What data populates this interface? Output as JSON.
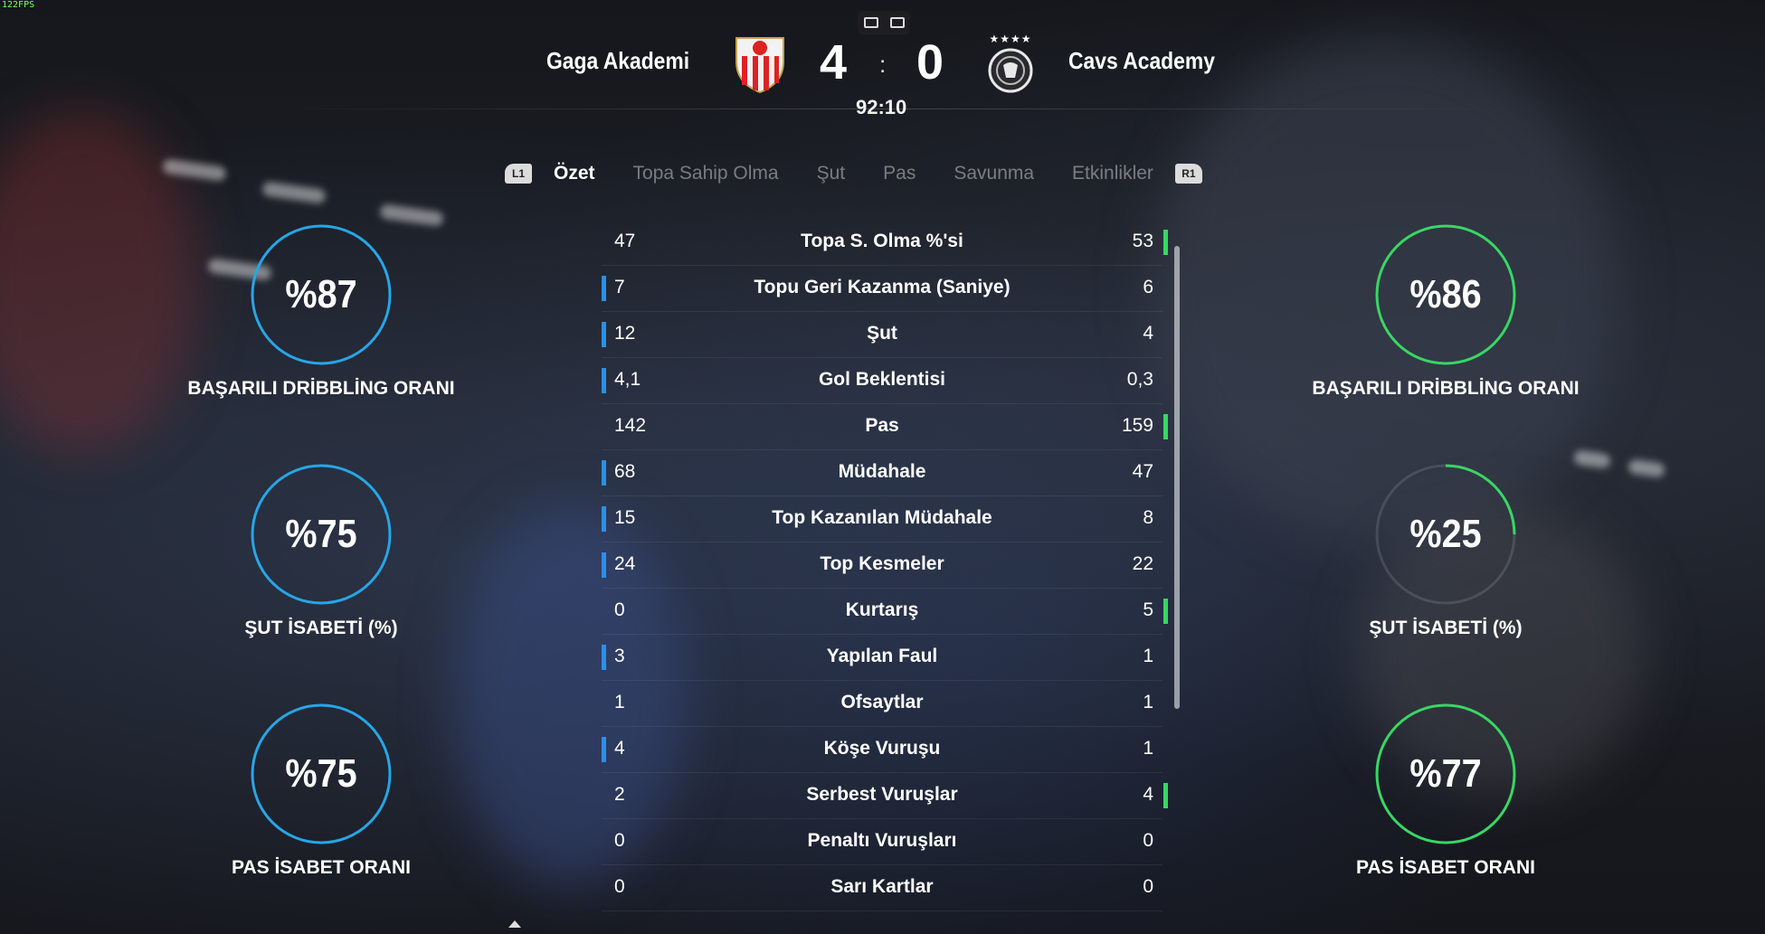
{
  "fps": "122FPS",
  "header": {
    "home_team": "Gaga Akademi",
    "away_team": "Cavs Academy",
    "home_score": "4",
    "away_score": "0",
    "separator": ":",
    "clock": "92:10",
    "home_crest": "sevilla-crest-icon",
    "away_crest": "germany-crest-icon",
    "away_stars": "★★★★"
  },
  "tabs": {
    "left_bumper": "L1",
    "right_bumper": "R1",
    "items": [
      "Özet",
      "Topa Sahip Olma",
      "Şut",
      "Pas",
      "Savunma",
      "Etkinlikler"
    ]
  },
  "gauges": {
    "home": [
      {
        "value": "%87",
        "label": "BAŞARILI DRİBBLİNG ORANI"
      },
      {
        "value": "%75",
        "label": "ŞUT İSABETİ (%)"
      },
      {
        "value": "%75",
        "label": "PAS İSABET ORANI"
      }
    ],
    "away": [
      {
        "value": "%86",
        "label": "BAŞARILI DRİBBLİNG ORANI"
      },
      {
        "value": "%25",
        "label": "ŞUT İSABETİ (%)"
      },
      {
        "value": "%77",
        "label": "PAS İSABET ORANI"
      }
    ]
  },
  "stats": [
    {
      "name": "Topa S. Olma %'si",
      "home": "47",
      "away": "53",
      "leader": "away"
    },
    {
      "name": "Topu Geri Kazanma (Saniye)",
      "home": "7",
      "away": "6",
      "leader": "home"
    },
    {
      "name": "Şut",
      "home": "12",
      "away": "4",
      "leader": "home"
    },
    {
      "name": "Gol Beklentisi",
      "home": "4,1",
      "away": "0,3",
      "leader": "home"
    },
    {
      "name": "Pas",
      "home": "142",
      "away": "159",
      "leader": "away"
    },
    {
      "name": "Müdahale",
      "home": "68",
      "away": "47",
      "leader": "home"
    },
    {
      "name": "Top Kazanılan Müdahale",
      "home": "15",
      "away": "8",
      "leader": "home"
    },
    {
      "name": "Top Kesmeler",
      "home": "24",
      "away": "22",
      "leader": "home"
    },
    {
      "name": "Kurtarış",
      "home": "0",
      "away": "5",
      "leader": "away"
    },
    {
      "name": "Yapılan Faul",
      "home": "3",
      "away": "1",
      "leader": "home"
    },
    {
      "name": "Ofsaytlar",
      "home": "1",
      "away": "1",
      "leader": "none"
    },
    {
      "name": "Köşe Vuruşu",
      "home": "4",
      "away": "1",
      "leader": "home"
    },
    {
      "name": "Serbest Vuruşlar",
      "home": "2",
      "away": "4",
      "leader": "away"
    },
    {
      "name": "Penaltı Vuruşları",
      "home": "0",
      "away": "0",
      "leader": "none"
    },
    {
      "name": "Sarı Kartlar",
      "home": "0",
      "away": "0",
      "leader": "none"
    }
  ],
  "colors": {
    "home_accent": "#2c8fe6",
    "away_accent": "#37d765"
  }
}
